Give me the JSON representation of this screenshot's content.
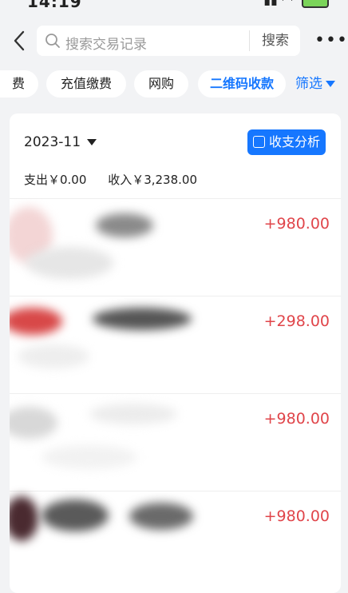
{
  "status": {
    "time": "14:19"
  },
  "search": {
    "placeholder": "搜索交易记录",
    "button_label": "搜索"
  },
  "chips": [
    {
      "label": "费"
    },
    {
      "label": "充值缴费"
    },
    {
      "label": "网购"
    },
    {
      "label": "二维码收款",
      "active": true
    }
  ],
  "filter_label": "筛选",
  "summary_card": {
    "month": "2023-11",
    "analysis_label": "收支分析",
    "expense": "支出￥0.00",
    "income": "收入￥3,238.00"
  },
  "transactions": [
    {
      "amount": "+980.00"
    },
    {
      "amount": "+298.00"
    },
    {
      "amount": "+980.00"
    },
    {
      "amount": "+980.00"
    }
  ],
  "colors": {
    "accent": "#1677ff",
    "amount": "#e0454a"
  }
}
